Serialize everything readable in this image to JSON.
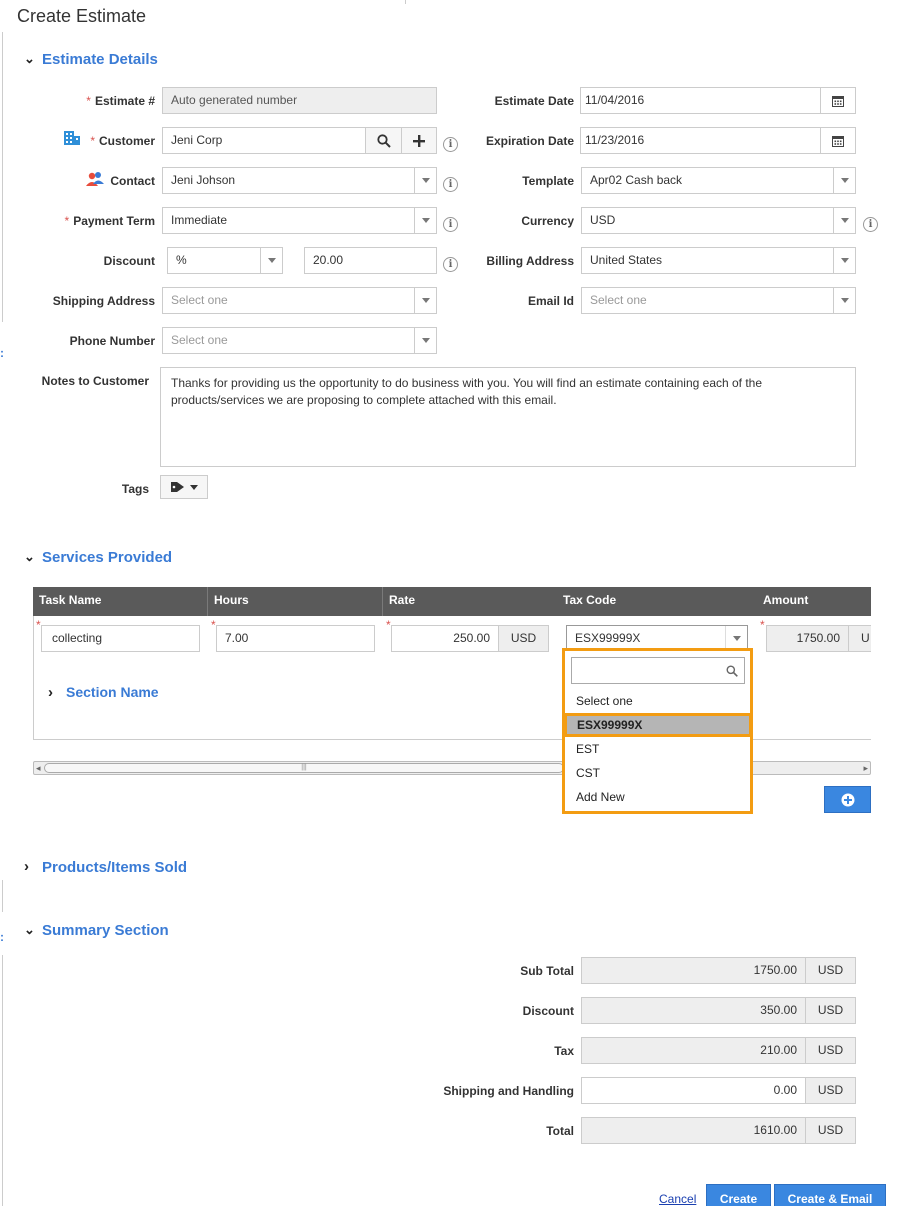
{
  "page": {
    "title": "Create Estimate"
  },
  "sections": {
    "estimate_details": "Estimate Details",
    "services_provided": "Services Provided",
    "products_items_sold": "Products/Items Sold",
    "summary": "Summary Section"
  },
  "details": {
    "estimate_no": {
      "label": "Estimate #",
      "placeholder": "Auto generated number"
    },
    "customer": {
      "label": "Customer",
      "value": "Jeni Corp"
    },
    "contact": {
      "label": "Contact",
      "value": "Jeni Johson"
    },
    "payment_term": {
      "label": "Payment Term",
      "value": "Immediate"
    },
    "discount": {
      "label": "Discount",
      "type": "%",
      "value": "20.00"
    },
    "shipping_address": {
      "label": "Shipping Address",
      "placeholder": "Select one"
    },
    "phone_number": {
      "label": "Phone Number",
      "placeholder": "Select one"
    },
    "estimate_date": {
      "label": "Estimate Date",
      "value": "11/04/2016"
    },
    "expiration_date": {
      "label": "Expiration Date",
      "value": "11/23/2016"
    },
    "template": {
      "label": "Template",
      "value": "Apr02 Cash back"
    },
    "currency": {
      "label": "Currency",
      "value": "USD"
    },
    "billing_address": {
      "label": "Billing Address",
      "value": "United States"
    },
    "email_id": {
      "label": "Email Id",
      "placeholder": "Select one"
    },
    "notes": {
      "label": "Notes to Customer",
      "value": "Thanks for providing us the opportunity to do business with you. You will find an estimate containing each of the products/services we are proposing to complete attached with this email."
    },
    "tags": {
      "label": "Tags"
    }
  },
  "services": {
    "columns": [
      "Task Name",
      "Hours",
      "Rate",
      "Tax Code",
      "Amount"
    ],
    "row": {
      "task": "collecting",
      "hours": "7.00",
      "rate": "250.00",
      "rate_unit": "USD",
      "tax_code": "ESX99999X",
      "amount": "1750.00",
      "amount_unit": "U"
    },
    "section_name": "Section Name",
    "tax_dropdown": {
      "search_placeholder": "",
      "options": [
        "Select one",
        "ESX99999X",
        "EST",
        "CST",
        "Add New"
      ],
      "highlighted": "ESX99999X"
    },
    "add_button_icon": "plus-circle-icon"
  },
  "summary": {
    "sub_total": {
      "label": "Sub Total",
      "value": "1750.00",
      "unit": "USD"
    },
    "discount": {
      "label": "Discount",
      "value": "350.00",
      "unit": "USD"
    },
    "tax": {
      "label": "Tax",
      "value": "210.00",
      "unit": "USD"
    },
    "shipping": {
      "label": "Shipping and Handling",
      "value": "0.00",
      "unit": "USD"
    },
    "total": {
      "label": "Total",
      "value": "1610.00",
      "unit": "USD"
    }
  },
  "actions": {
    "cancel": "Cancel",
    "create": "Create",
    "create_email": "Create & Email"
  },
  "colors": {
    "accent": "#3a7bd5",
    "highlight_border": "#f39c12",
    "button": "#3a87e0",
    "table_header": "#5a5a5a"
  }
}
